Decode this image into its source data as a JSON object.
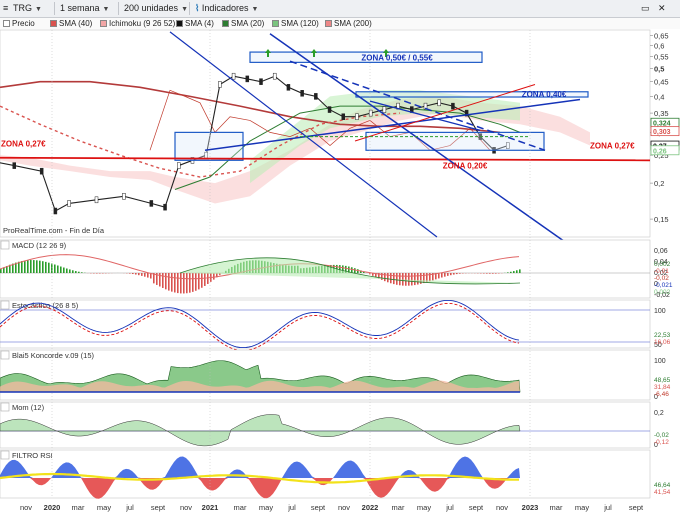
{
  "toolbar": {
    "ticker": "TRG",
    "period": "1 semana",
    "units": "200 unidades",
    "indicators": "Indicadores"
  },
  "legend": [
    {
      "label": "Precio",
      "color": "#ffffff"
    },
    {
      "label": "SMA (40)",
      "color": "#d9534f"
    },
    {
      "label": "Ichimoku (9 26 52)",
      "color": "#f2a6a6"
    },
    {
      "label": "SMA (4)",
      "color": "#111111"
    },
    {
      "label": "SMA (20)",
      "color": "#2e7d32"
    },
    {
      "label": "SMA (120)",
      "color": "#7bc47f"
    },
    {
      "label": "SMA (200)",
      "color": "#e88"
    }
  ],
  "chart_data": {
    "type": "line",
    "x_labels": [
      "nov",
      "2020",
      "mar",
      "may",
      "jul",
      "sept",
      "nov",
      "2021",
      "mar",
      "may",
      "jul",
      "sept",
      "nov",
      "2022",
      "mar",
      "may",
      "jul",
      "sept",
      "nov",
      "2023",
      "mar",
      "may",
      "jul",
      "sept"
    ],
    "price_axis_ticks": [
      "0,65",
      "0,6",
      "0,55",
      "0,5",
      "0,45",
      "0,4",
      "0,35",
      "0,3",
      "0,25",
      "0,2",
      "0,15"
    ],
    "price_scale": "log",
    "price": {
      "dates": [
        "2019-10",
        "2019-12",
        "2020-02",
        "2020-03",
        "2020-04",
        "2020-06",
        "2020-08",
        "2020-10",
        "2020-11",
        "2020-12",
        "2021-01",
        "2021-02",
        "2021-03",
        "2021-04",
        "2021-05",
        "2021-06",
        "2021-07",
        "2021-08",
        "2021-09",
        "2021-10",
        "2021-11",
        "2021-12",
        "2022-01",
        "2022-02",
        "2022-03",
        "2022-04",
        "2022-05",
        "2022-06",
        "2022-07",
        "2022-08",
        "2022-09",
        "2022-10",
        "2022-11",
        "2022-12"
      ],
      "close": [
        0.24,
        0.23,
        0.22,
        0.16,
        0.17,
        0.175,
        0.18,
        0.17,
        0.165,
        0.23,
        0.24,
        0.25,
        0.44,
        0.47,
        0.46,
        0.45,
        0.47,
        0.43,
        0.41,
        0.4,
        0.36,
        0.34,
        0.34,
        0.35,
        0.36,
        0.37,
        0.36,
        0.37,
        0.38,
        0.37,
        0.35,
        0.29,
        0.26,
        0.27
      ]
    },
    "last_prices": [
      "0,324",
      "0,303",
      "0,27",
      "0,26"
    ],
    "zones": [
      {
        "label": "ZONA 0,50€ / 0,55€"
      },
      {
        "label": "ZONA 0,40€"
      },
      {
        "label": "ZONA 0,27€"
      },
      {
        "label": "ZONA 0,20€"
      }
    ],
    "source_text": "ProRealTime.com - Fin de Día",
    "panels": [
      {
        "name": "MACD (12 26 9)",
        "ticks": [
          "0,06",
          "0,04",
          "0,02",
          "0",
          "-0,02"
        ],
        "values": [
          "0,002",
          "-0,01",
          "-0,02",
          "-0,021",
          "0,002"
        ]
      },
      {
        "name": "Estocástico (26 8 5)",
        "ticks": [
          "100",
          "50"
        ],
        "values": [
          "22,53",
          "16,06"
        ]
      },
      {
        "name": "Blai5 Koncorde v.09 (15)",
        "ticks": [
          "100",
          "0"
        ],
        "values": [
          "48,65",
          "31,84",
          "-6,46"
        ]
      },
      {
        "name": "Mom (12)",
        "ticks": [
          "0,2",
          "0"
        ],
        "values": [
          "-0,02",
          "-0,12"
        ]
      },
      {
        "name": "FILTRO RSI",
        "ticks": [],
        "values": [
          "46,64",
          "41,54"
        ]
      }
    ]
  }
}
